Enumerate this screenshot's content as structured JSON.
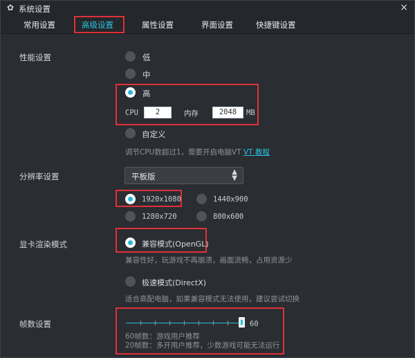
{
  "window": {
    "title": "系统设置",
    "close_glyph": "×",
    "icon": "gear-icon"
  },
  "tabs": [
    {
      "label": "常用设置",
      "active": false
    },
    {
      "label": "高级设置",
      "active": true
    },
    {
      "label": "属性设置",
      "active": false
    },
    {
      "label": "界面设置",
      "active": false
    },
    {
      "label": "快捷键设置",
      "active": false
    }
  ],
  "performance": {
    "label": "性能设置",
    "options": [
      "低",
      "中",
      "高",
      "自定义"
    ],
    "selected": "高",
    "cpu_label": "CPU",
    "cpu_value": "2",
    "memory_label": "内存",
    "memory_value": "2048",
    "memory_unit": "MB",
    "hint_prefix": "调节CPU数超过1，需要开启电脑VT",
    "hint_link": "VT 教程"
  },
  "resolution": {
    "label": "分辨率设置",
    "device": "平板版",
    "options": [
      "1920x1080",
      "1440x900",
      "1280x720",
      "800x600"
    ],
    "selected": "1920x1080"
  },
  "render": {
    "label": "显卡渲染模式",
    "compat_label": "兼容模式(OpenGL)",
    "compat_hint": "兼容性好，玩游戏不再崩溃，画面流畅，占用资源少",
    "speed_label": "极速模式(DirectX)",
    "speed_hint": "适合高配电脑，如果兼容模式无法使用，建议尝试切换",
    "selected": "兼容模式(OpenGL)"
  },
  "fps": {
    "label": "帧数设置",
    "value": "60",
    "level": 1.0,
    "hint1": "60帧数：游戏用户推荐",
    "hint2": "20帧数：多开用户推荐，少数游戏可能无法运行"
  },
  "colors": {
    "accent": "#2bc1e0",
    "highlight": "#e0313a",
    "background": "#2a2d31"
  }
}
